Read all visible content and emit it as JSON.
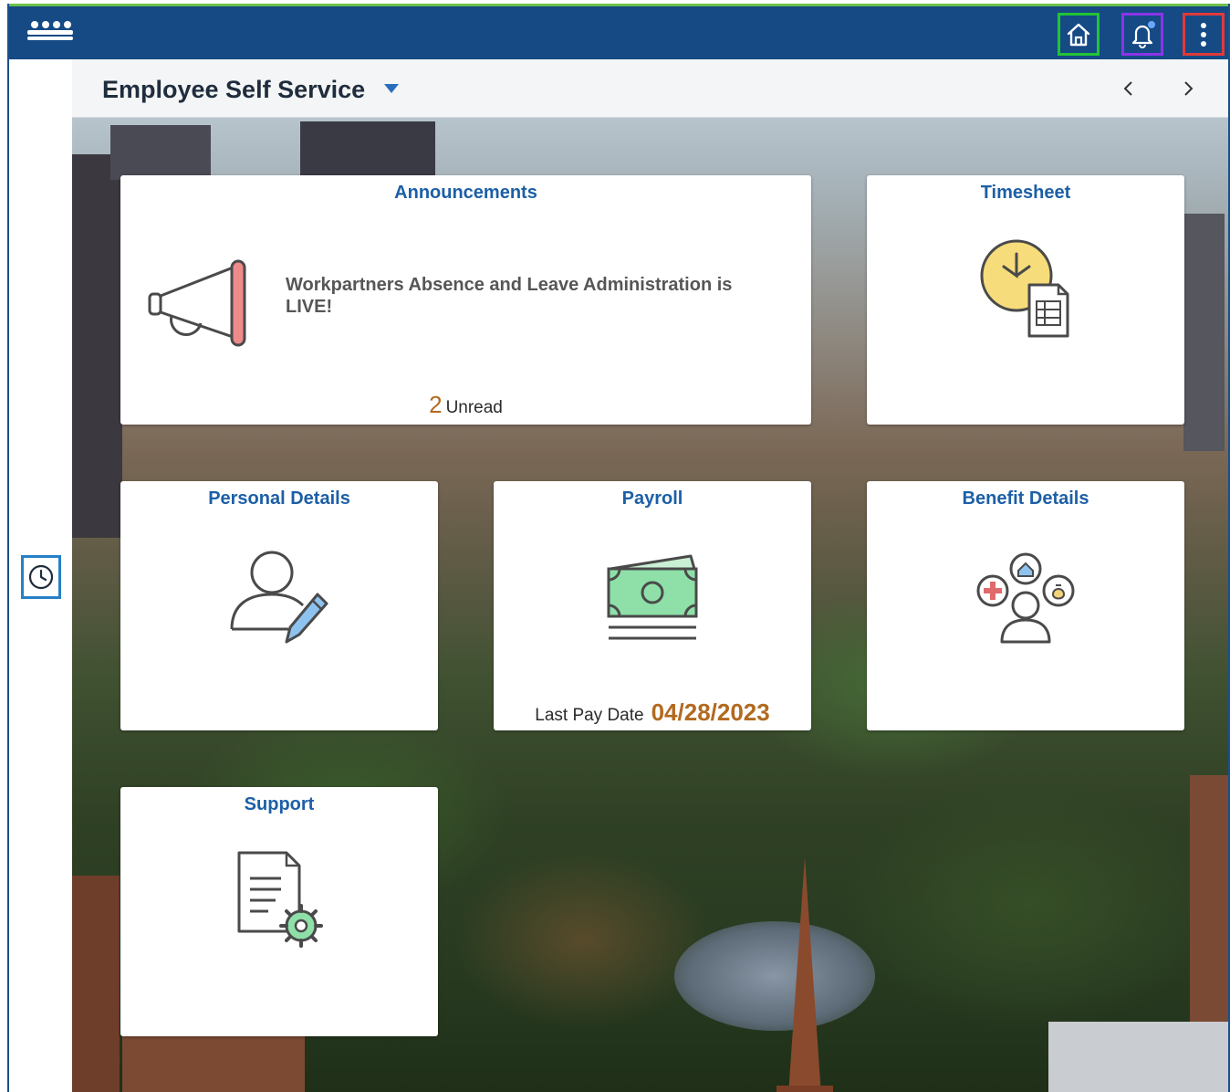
{
  "header": {
    "logo_icon": "people-group-icon",
    "home_icon": "home-icon",
    "notifications_icon": "bell-icon",
    "menu_icon": "kebab-menu-icon"
  },
  "titlebar": {
    "title": "Employee Self Service",
    "dropdown_icon": "caret-down-icon",
    "prev_icon": "chevron-left-icon",
    "next_icon": "chevron-right-icon"
  },
  "sidebar": {
    "recent_icon": "clock-icon"
  },
  "tiles": {
    "announcements": {
      "title": "Announcements",
      "message": "Workpartners Absence and Leave Administration is LIVE!",
      "unread_count": "2",
      "unread_label": "Unread",
      "icon": "megaphone-icon"
    },
    "timesheet": {
      "title": "Timesheet",
      "icon": "clock-timesheet-icon"
    },
    "personal_details": {
      "title": "Personal Details",
      "icon": "person-edit-icon"
    },
    "payroll": {
      "title": "Payroll",
      "last_pay_label": "Last Pay Date",
      "last_pay_date": "04/28/2023",
      "icon": "money-icon"
    },
    "benefit_details": {
      "title": "Benefit Details",
      "icon": "benefits-icon"
    },
    "support": {
      "title": "Support",
      "icon": "document-gear-icon"
    }
  },
  "colors": {
    "header_bg": "#154a85",
    "tile_title": "#1c5fa6",
    "highlight_value": "#b26a1f",
    "home_outline": "#22c436",
    "bell_outline": "#8a34e8",
    "menu_outline": "#e03a3a",
    "recent_outline": "#2580c7"
  }
}
